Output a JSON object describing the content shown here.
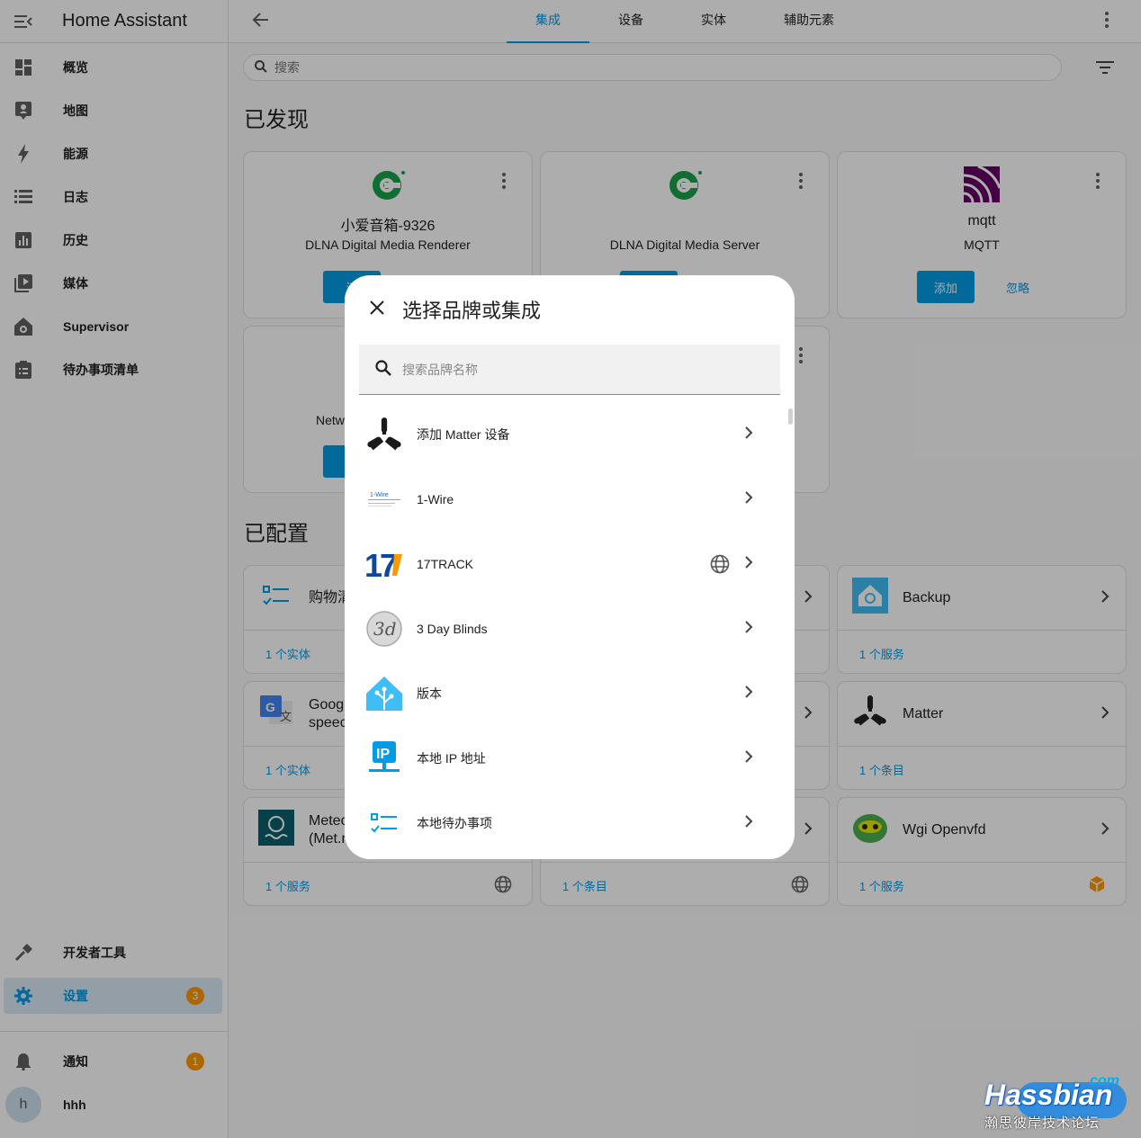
{
  "app": {
    "title": "Home Assistant"
  },
  "sidebar": {
    "items": [
      {
        "label": "概览"
      },
      {
        "label": "地图"
      },
      {
        "label": "能源"
      },
      {
        "label": "日志"
      },
      {
        "label": "历史"
      },
      {
        "label": "媒体"
      },
      {
        "label": "Supervisor"
      },
      {
        "label": "待办事项清单"
      }
    ],
    "dev_tools": "开发者工具",
    "settings": {
      "label": "设置",
      "badge": "3"
    },
    "notifications": {
      "label": "通知",
      "badge": "1"
    },
    "user": {
      "initial": "h",
      "name": "hhh"
    }
  },
  "topbar": {
    "tabs": [
      "集成",
      "设备",
      "实体",
      "辅助元素"
    ],
    "active_tab": "集成"
  },
  "search": {
    "placeholder": "搜索"
  },
  "discovered": {
    "heading": "已发现",
    "cards": [
      {
        "title": "小爱音箱-9326",
        "subtitle": "DLNA Digital Media Renderer",
        "add": "添"
      },
      {
        "title": "",
        "subtitle": "DLNA Digital Media Server"
      },
      {
        "title": "mqtt",
        "subtitle": "MQTT",
        "add": "添加",
        "ignore": "忽略"
      },
      {
        "title": "Netw",
        "add": "添"
      }
    ]
  },
  "configured": {
    "heading": "已配置",
    "cards": [
      {
        "name": "购物清",
        "footer": "1 个实体"
      },
      {
        "name": "Backup",
        "footer": "1 个服务"
      },
      {
        "name1": "Googl",
        "name2": "speec",
        "footer": "1 个实体"
      },
      {
        "name": "Matter",
        "footer": "1 个条目"
      },
      {
        "name1": "Meteo",
        "name2": "(Met.r",
        "footer": "1 个服务"
      },
      {
        "name": "",
        "footer": "1 个条目"
      },
      {
        "name": "Wgi Openvfd",
        "footer": "1 个服务"
      }
    ]
  },
  "dialog": {
    "title": "选择品牌或集成",
    "search_placeholder": "搜索品牌名称",
    "items": [
      {
        "label": "添加 Matter 设备",
        "icon": "matter-icon"
      },
      {
        "label": "1-Wire",
        "icon": "1wire-icon"
      },
      {
        "label": "17TRACK",
        "icon": "17track-icon",
        "cloud": true
      },
      {
        "label": "3 Day Blinds",
        "icon": "3day-blinds-icon"
      },
      {
        "label": "版本",
        "icon": "home-assistant-icon"
      },
      {
        "label": "本地 IP 地址",
        "icon": "ip-icon"
      },
      {
        "label": "本地待办事项",
        "icon": "todo-icon"
      }
    ]
  },
  "watermark": {
    "com": "com",
    "name": "Hassbian",
    "sub": "瀚思彼岸技术论坛"
  },
  "colors": {
    "primary": "#039be5",
    "badge": "#ff9800",
    "scrim": "rgba(0,0,0,0.32)"
  }
}
